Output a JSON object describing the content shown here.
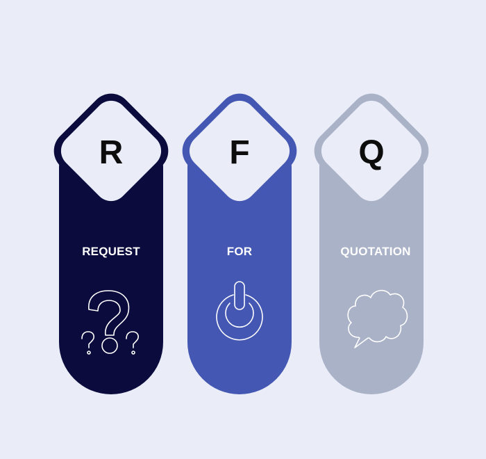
{
  "pillars": [
    {
      "letter": "R",
      "word": "REQUEST",
      "color": "#0b0b3d",
      "icon": "question-marks-icon"
    },
    {
      "letter": "F",
      "word": "FOR",
      "color": "#4357b3",
      "icon": "power-icon"
    },
    {
      "letter": "Q",
      "word": "QUOTATION",
      "color": "#aab2c8",
      "icon": "speech-bubble-icon"
    }
  ],
  "colors": {
    "background": "#eaedf8",
    "diamond_fill": "#eaedf8",
    "letter": "#0d0d0d",
    "icon_stroke": "#ffffff"
  }
}
